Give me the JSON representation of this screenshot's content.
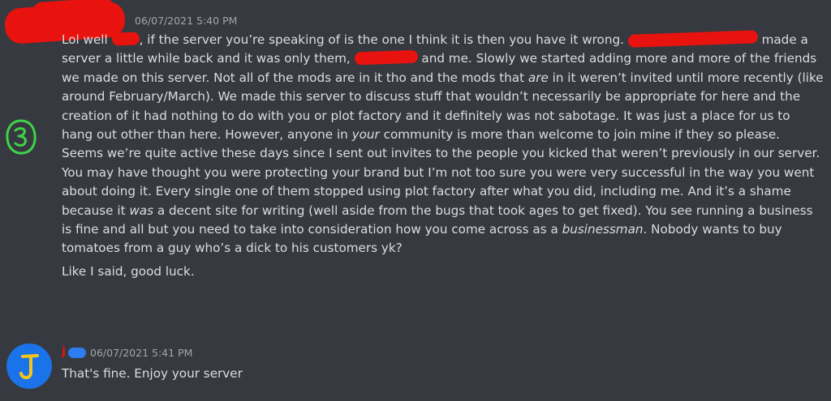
{
  "messages": [
    {
      "timestamp": "06/07/2021 5:40 PM",
      "paragraphs": {
        "p1_a": "Lol well ",
        "p1_b": ", if the server you’re speaking of is the one I think it is then you have it wrong. ",
        "p1_c": " made a server a little while back and it was only them, ",
        "p1_d": " and me. Slowly we started adding more and more of the friends we made on this server. Not all of the mods are in it tho and the mods that ",
        "p1_e": "are",
        "p1_f": " in it weren’t invited until more recently (like around February/March). We made this server to discuss stuff that wouldn’t necessarily be appropriate for here and the creation of it had nothing to do with you or plot factory and it definitely was not sabotage. It was just a place for us to hang out other than here. However, anyone in ",
        "p1_g": "your",
        "p1_h": " community is more than welcome to join mine if they so please.   Seems we’re quite active these days since I sent out invites to the people you kicked that weren’t previously in our server. You may have thought you were protecting your brand but I’m not too sure you were very successful in the way you went about doing it. Every single one of them stopped using plot factory after what you did, including me. And it’s a shame because it ",
        "p1_i": "was",
        "p1_j": " a decent site for writing (well aside from the bugs that took ages to get fixed). You see running a business is fine and all but you need to take into consideration how you come across as a ",
        "p1_k": "businessman",
        "p1_l": ". Nobody wants to buy tomatoes from a guy who’s a dick to his customers yk?",
        "p2": "Like I said, good luck."
      }
    },
    {
      "username_visible": "j",
      "timestamp": "06/07/2021 5:41 PM",
      "text": "That's fine. Enjoy your server",
      "avatar_letter": "J"
    }
  ],
  "colors": {
    "background": "#36393f",
    "text": "#dcddde",
    "timestamp": "#a3a6aa",
    "redaction": "#e8130f",
    "annotation_green": "#3fd34a",
    "avatar_blue": "#1a73e8",
    "avatar_letter": "#f5c518"
  },
  "icons": {
    "annotation": "handwritten-3-circle-icon"
  }
}
